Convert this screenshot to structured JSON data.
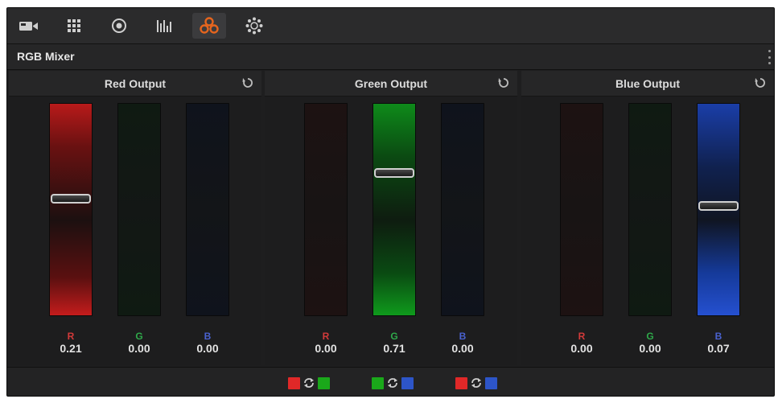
{
  "toolbar": {
    "icons": [
      "camera-raw-icon",
      "color-match-icon",
      "color-wheels-icon",
      "rgb-mixer-tab-icon",
      "motion-effects-icon",
      "curves-icon"
    ],
    "active_index": 4,
    "accent_color": "#e5651e"
  },
  "panel": {
    "title": "RGB Mixer"
  },
  "outputs": [
    {
      "title": "Red Output",
      "channels": [
        {
          "label": "R",
          "value": "0.21",
          "level": 0.44
        },
        {
          "label": "G",
          "value": "0.00"
        },
        {
          "label": "B",
          "value": "0.00"
        }
      ]
    },
    {
      "title": "Green Output",
      "channels": [
        {
          "label": "R",
          "value": "0.00"
        },
        {
          "label": "G",
          "value": "0.71",
          "level": 0.67
        },
        {
          "label": "B",
          "value": "0.00"
        }
      ]
    },
    {
      "title": "Blue Output",
      "channels": [
        {
          "label": "R",
          "value": "0.00"
        },
        {
          "label": "G",
          "value": "0.00"
        },
        {
          "label": "B",
          "value": "0.07",
          "level": 0.52
        }
      ]
    }
  ],
  "colors": {
    "red": "#e02828",
    "green": "#1aa81a",
    "blue": "#2d55c8",
    "label_r": "#d23a3a",
    "label_g": "#2fa84a",
    "label_b": "#4a62d0"
  },
  "footer": {
    "swaps": [
      {
        "left": "red",
        "right": "green"
      },
      {
        "left": "green",
        "right": "blue"
      },
      {
        "left": "red",
        "right": "blue"
      }
    ]
  }
}
